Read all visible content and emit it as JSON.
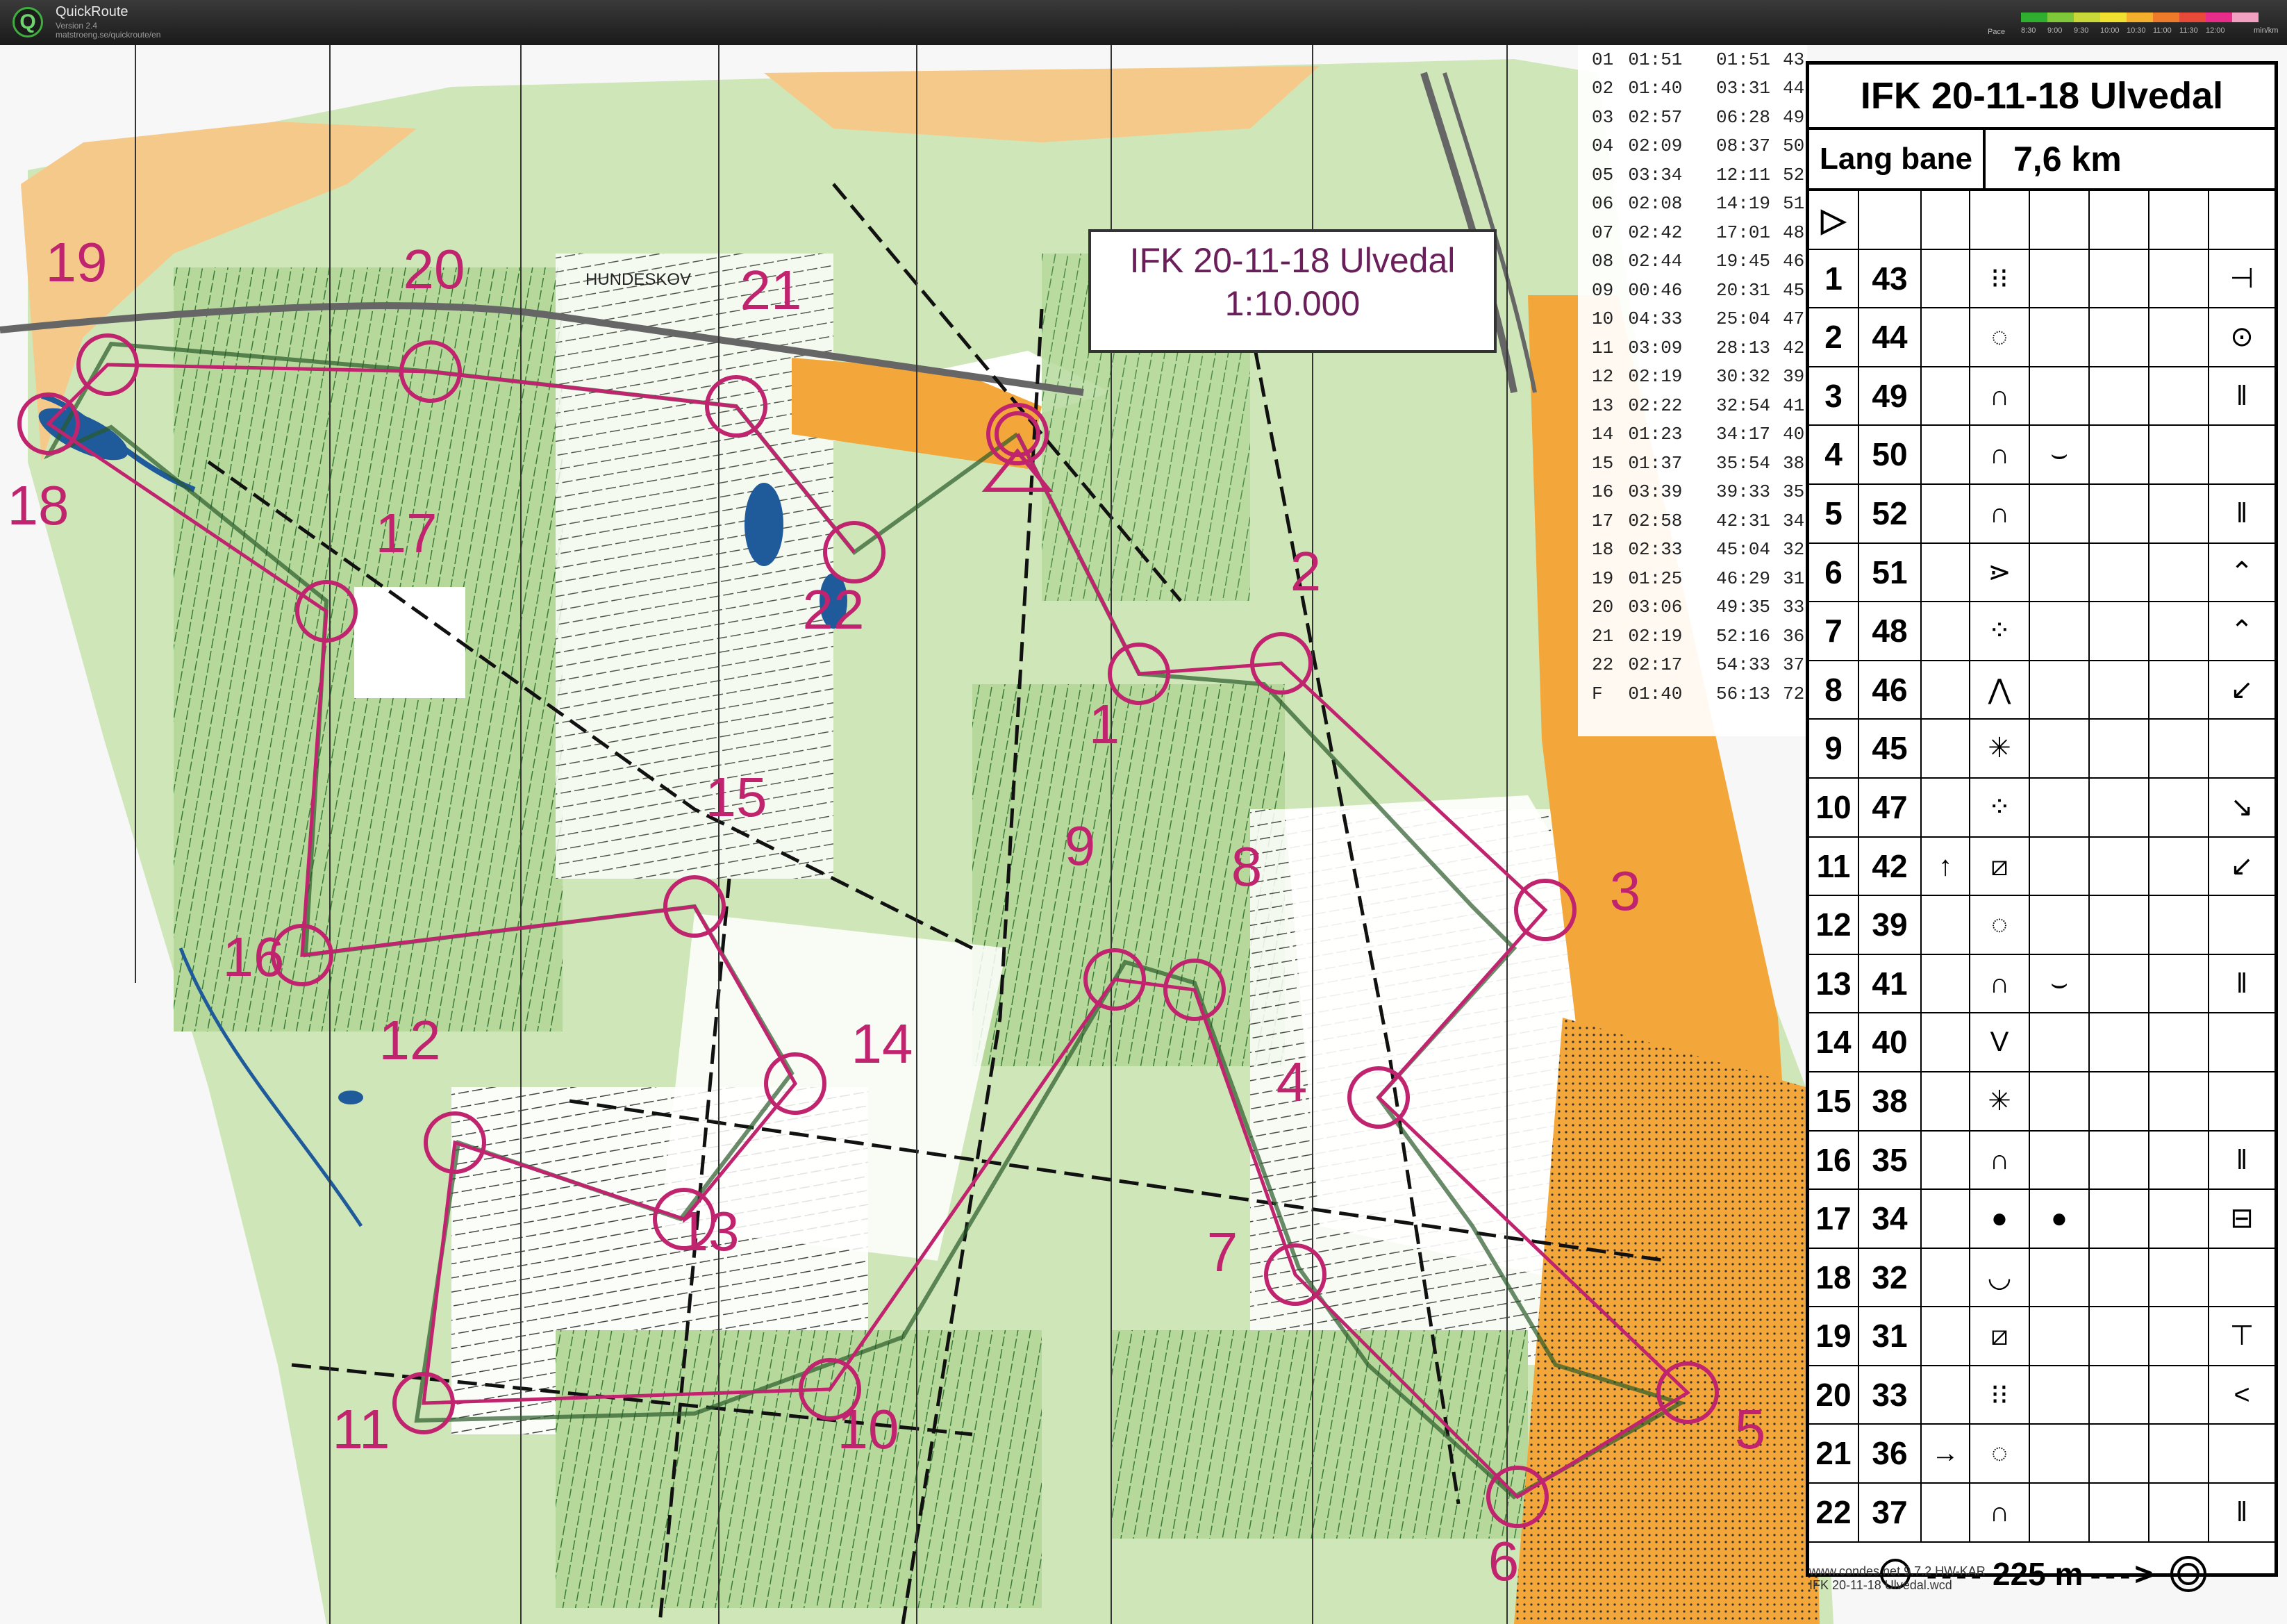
{
  "app": {
    "title": "QuickRoute",
    "version": "Version 2.4",
    "url": "matstroeng.se/quickroute/en"
  },
  "pace_legend": {
    "label": "Pace",
    "ticks": [
      "8:30",
      "9:00",
      "9:30",
      "10:00",
      "10:30",
      "11:00",
      "11:30",
      "12:00"
    ],
    "unit": "min/km",
    "colors": [
      "#2fae2f",
      "#7fc83a",
      "#c8d838",
      "#f0e030",
      "#f2b02c",
      "#ee7a2a",
      "#e84a3a",
      "#e82c8a",
      "#f0a0c0"
    ]
  },
  "map_title_box": {
    "line1": "IFK 20-11-18 Ulvedal",
    "line2": "1:10.000"
  },
  "map_place_label": "HUNDESKOV",
  "split_times": [
    {
      "leg": "01",
      "split": "01:51",
      "total": "01:51",
      "pace": "43"
    },
    {
      "leg": "02",
      "split": "01:40",
      "total": "03:31",
      "pace": "44"
    },
    {
      "leg": "03",
      "split": "02:57",
      "total": "06:28",
      "pace": "49"
    },
    {
      "leg": "04",
      "split": "02:09",
      "total": "08:37",
      "pace": "50"
    },
    {
      "leg": "05",
      "split": "03:34",
      "total": "12:11",
      "pace": "52"
    },
    {
      "leg": "06",
      "split": "02:08",
      "total": "14:19",
      "pace": "51"
    },
    {
      "leg": "07",
      "split": "02:42",
      "total": "17:01",
      "pace": "48"
    },
    {
      "leg": "08",
      "split": "02:44",
      "total": "19:45",
      "pace": "46"
    },
    {
      "leg": "09",
      "split": "00:46",
      "total": "20:31",
      "pace": "45"
    },
    {
      "leg": "10",
      "split": "04:33",
      "total": "25:04",
      "pace": "47"
    },
    {
      "leg": "11",
      "split": "03:09",
      "total": "28:13",
      "pace": "42"
    },
    {
      "leg": "12",
      "split": "02:19",
      "total": "30:32",
      "pace": "39"
    },
    {
      "leg": "13",
      "split": "02:22",
      "total": "32:54",
      "pace": "41"
    },
    {
      "leg": "14",
      "split": "01:23",
      "total": "34:17",
      "pace": "40"
    },
    {
      "leg": "15",
      "split": "01:37",
      "total": "35:54",
      "pace": "38"
    },
    {
      "leg": "16",
      "split": "03:39",
      "total": "39:33",
      "pace": "35"
    },
    {
      "leg": "17",
      "split": "02:58",
      "total": "42:31",
      "pace": "34"
    },
    {
      "leg": "18",
      "split": "02:33",
      "total": "45:04",
      "pace": "32"
    },
    {
      "leg": "19",
      "split": "01:25",
      "total": "46:29",
      "pace": "31"
    },
    {
      "leg": "20",
      "split": "03:06",
      "total": "49:35",
      "pace": "33"
    },
    {
      "leg": "21",
      "split": "02:19",
      "total": "52:16",
      "pace": "36"
    },
    {
      "leg": "22",
      "split": "02:17",
      "total": "54:33",
      "pace": "37"
    },
    {
      "leg": "F",
      "split": "01:40",
      "total": "56:13",
      "pace": "72"
    }
  ],
  "description_sheet": {
    "title": "IFK 20-11-18 Ulvedal",
    "course": "Lang bane",
    "length": "7,6 km",
    "start_symbol": "▷",
    "rows": [
      {
        "n": "1",
        "code": "43",
        "c": "",
        "d": "⁝⁝",
        "e": "",
        "g": "⊣"
      },
      {
        "n": "2",
        "code": "44",
        "c": "",
        "d": "◌",
        "e": "",
        "g": "⊙"
      },
      {
        "n": "3",
        "code": "49",
        "c": "",
        "d": "∩",
        "e": "",
        "g": "‖"
      },
      {
        "n": "4",
        "code": "50",
        "c": "",
        "d": "∩",
        "e": "⌣",
        "g": ""
      },
      {
        "n": "5",
        "code": "52",
        "c": "",
        "d": "∩",
        "e": "",
        "g": "‖"
      },
      {
        "n": "6",
        "code": "51",
        "c": "",
        "d": "⋗",
        "e": "",
        "g": "⌃"
      },
      {
        "n": "7",
        "code": "48",
        "c": "",
        "d": "⁘",
        "e": "",
        "g": "⌃"
      },
      {
        "n": "8",
        "code": "46",
        "c": "",
        "d": "⋀",
        "e": "",
        "g": "↙"
      },
      {
        "n": "9",
        "code": "45",
        "c": "",
        "d": "✳",
        "e": "",
        "g": ""
      },
      {
        "n": "10",
        "code": "47",
        "c": "",
        "d": "⁘",
        "e": "",
        "g": "↘"
      },
      {
        "n": "11",
        "code": "42",
        "c": "↑",
        "d": "⧄",
        "e": "",
        "g": "↙"
      },
      {
        "n": "12",
        "code": "39",
        "c": "",
        "d": "◌",
        "e": "",
        "g": ""
      },
      {
        "n": "13",
        "code": "41",
        "c": "",
        "d": "∩",
        "e": "⌣",
        "g": "‖"
      },
      {
        "n": "14",
        "code": "40",
        "c": "",
        "d": "V",
        "e": "",
        "g": ""
      },
      {
        "n": "15",
        "code": "38",
        "c": "",
        "d": "✳",
        "e": "",
        "g": ""
      },
      {
        "n": "16",
        "code": "35",
        "c": "",
        "d": "∩",
        "e": "",
        "g": "‖"
      },
      {
        "n": "17",
        "code": "34",
        "c": "",
        "d": "●",
        "e": "●",
        "g": "⊟"
      },
      {
        "n": "18",
        "code": "32",
        "c": "",
        "d": "◡",
        "e": "",
        "g": ""
      },
      {
        "n": "19",
        "code": "31",
        "c": "",
        "d": "⧄",
        "e": "",
        "g": "⊤"
      },
      {
        "n": "20",
        "code": "33",
        "c": "",
        "d": "⁝⁝",
        "e": "",
        "g": "<"
      },
      {
        "n": "21",
        "code": "36",
        "c": "→",
        "d": "◌",
        "e": "",
        "g": ""
      },
      {
        "n": "22",
        "code": "37",
        "c": "",
        "d": "∩",
        "e": "",
        "g": "‖"
      }
    ],
    "finish_distance": "225 m"
  },
  "controls": [
    {
      "n": "1"
    },
    {
      "n": "2"
    },
    {
      "n": "3"
    },
    {
      "n": "4"
    },
    {
      "n": "5"
    },
    {
      "n": "6"
    },
    {
      "n": "7"
    },
    {
      "n": "8"
    },
    {
      "n": "9"
    },
    {
      "n": "10"
    },
    {
      "n": "11"
    },
    {
      "n": "12"
    },
    {
      "n": "13"
    },
    {
      "n": "14"
    },
    {
      "n": "15"
    },
    {
      "n": "16"
    },
    {
      "n": "17"
    },
    {
      "n": "18"
    },
    {
      "n": "19"
    },
    {
      "n": "20"
    },
    {
      "n": "21"
    },
    {
      "n": "22"
    }
  ],
  "credit": {
    "line1": "www.condes.net 9.7.2 HW-KAR",
    "line2": "IFK 20-11-18 Ulvedal.wcd"
  },
  "colors": {
    "course": "#c0246e",
    "forest_green": "#a9d08e",
    "open_yellow": "#f5c98a",
    "orange": "#f3a73a",
    "water": "#1f5a9a"
  }
}
